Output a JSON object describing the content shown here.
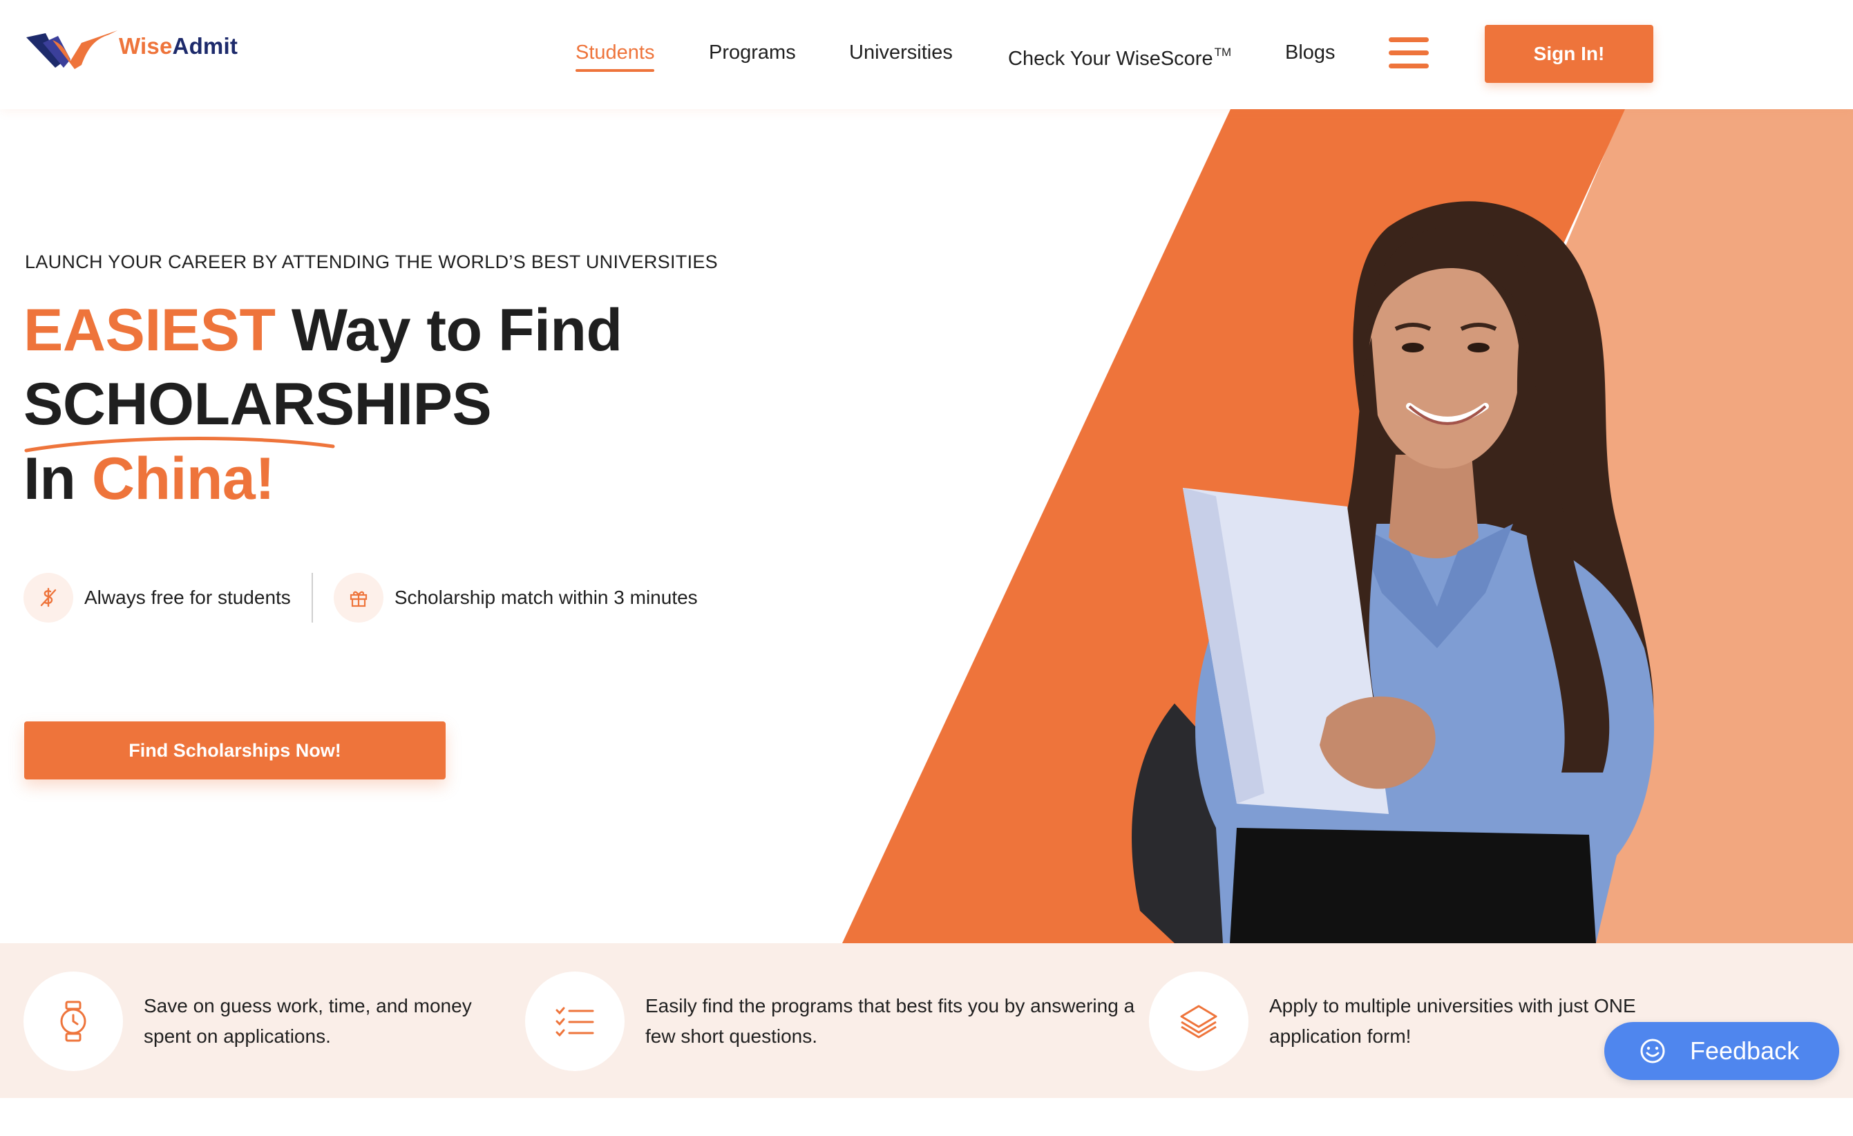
{
  "brand": {
    "name_part1": "Wise",
    "name_part2": "Admit",
    "accent_color": "#ee743b",
    "navy_color": "#1d2a6b"
  },
  "nav": {
    "items": [
      {
        "label": "Students",
        "active": true
      },
      {
        "label": "Programs",
        "active": false
      },
      {
        "label": "Universities",
        "active": false
      },
      {
        "label": "Check Your WiseScore",
        "superscript": "TM",
        "active": false
      },
      {
        "label": "Blogs",
        "active": false
      }
    ],
    "menu_icon": "hamburger-menu-icon",
    "signin_label": "Sign In!"
  },
  "hero": {
    "eyebrow": "LAUNCH YOUR CAREER BY ATTENDING THE WORLD’S BEST UNIVERSITIES",
    "headline_highlight": "EASIEST",
    "headline_rest": "Way to Find",
    "headline_line2": "SCHOLARSHIPS",
    "headline_line3_prefix": "In",
    "headline_line3_highlight": "China!",
    "features": [
      {
        "icon": "money-off-icon",
        "text": "Always free for students"
      },
      {
        "icon": "gift-icon",
        "text": "Scholarship match within 3 minutes"
      }
    ],
    "cta_label": "Find Scholarships Now!",
    "image": "student-holding-folder-photo",
    "bg_colors": {
      "primary": "#ee743b",
      "light": "#f2a77f"
    }
  },
  "benefits": [
    {
      "icon": "watch-icon",
      "text": "Save on guess work, time, and money spent on applications."
    },
    {
      "icon": "checklist-icon",
      "text": "Easily find the programs that best fits you by answering a few short questions."
    },
    {
      "icon": "layers-icon",
      "text": "Apply to multiple universities with just ONE application form!"
    }
  ],
  "feedback": {
    "label": "Feedback",
    "icon": "smiley-icon",
    "color": "#4f86ee"
  }
}
